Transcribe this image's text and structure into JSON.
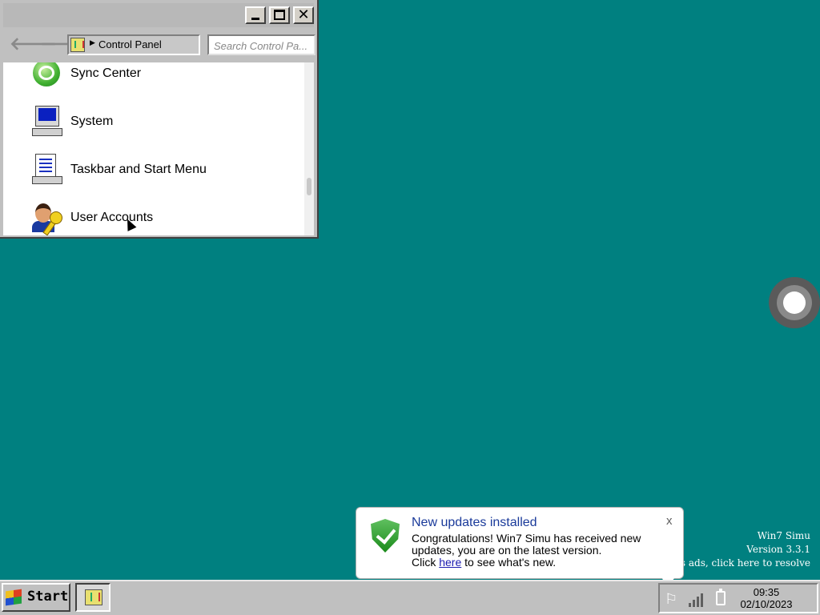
{
  "window": {
    "title": "",
    "address": "Control Panel",
    "search_placeholder": "Search Control Pa...",
    "items": [
      {
        "label": "Sync Center",
        "icon": "sync-center-icon"
      },
      {
        "label": "System",
        "icon": "system-icon"
      },
      {
        "label": "Taskbar and Start Menu",
        "icon": "taskbar-icon"
      },
      {
        "label": "User Accounts",
        "icon": "user-accounts-icon"
      }
    ]
  },
  "watermark": {
    "line1": "Win7 Simu",
    "line2": "Version 3.3.1",
    "line3": "tains ads, click here to resolve"
  },
  "notification": {
    "title": "New updates installed",
    "message_part1": "Congratulations! Win7 Simu has received new updates, you are on the latest version.",
    "message_part2": "Click ",
    "link_text": "here",
    "message_part3": " to see what's new.",
    "close_label": "x"
  },
  "taskbar": {
    "start_label": "Start",
    "time": "09:35",
    "date": "02/10/2023"
  },
  "colors": {
    "desktop": "#008080",
    "window_chrome": "#c0c0c0",
    "notification_title": "#1a3a9a"
  }
}
